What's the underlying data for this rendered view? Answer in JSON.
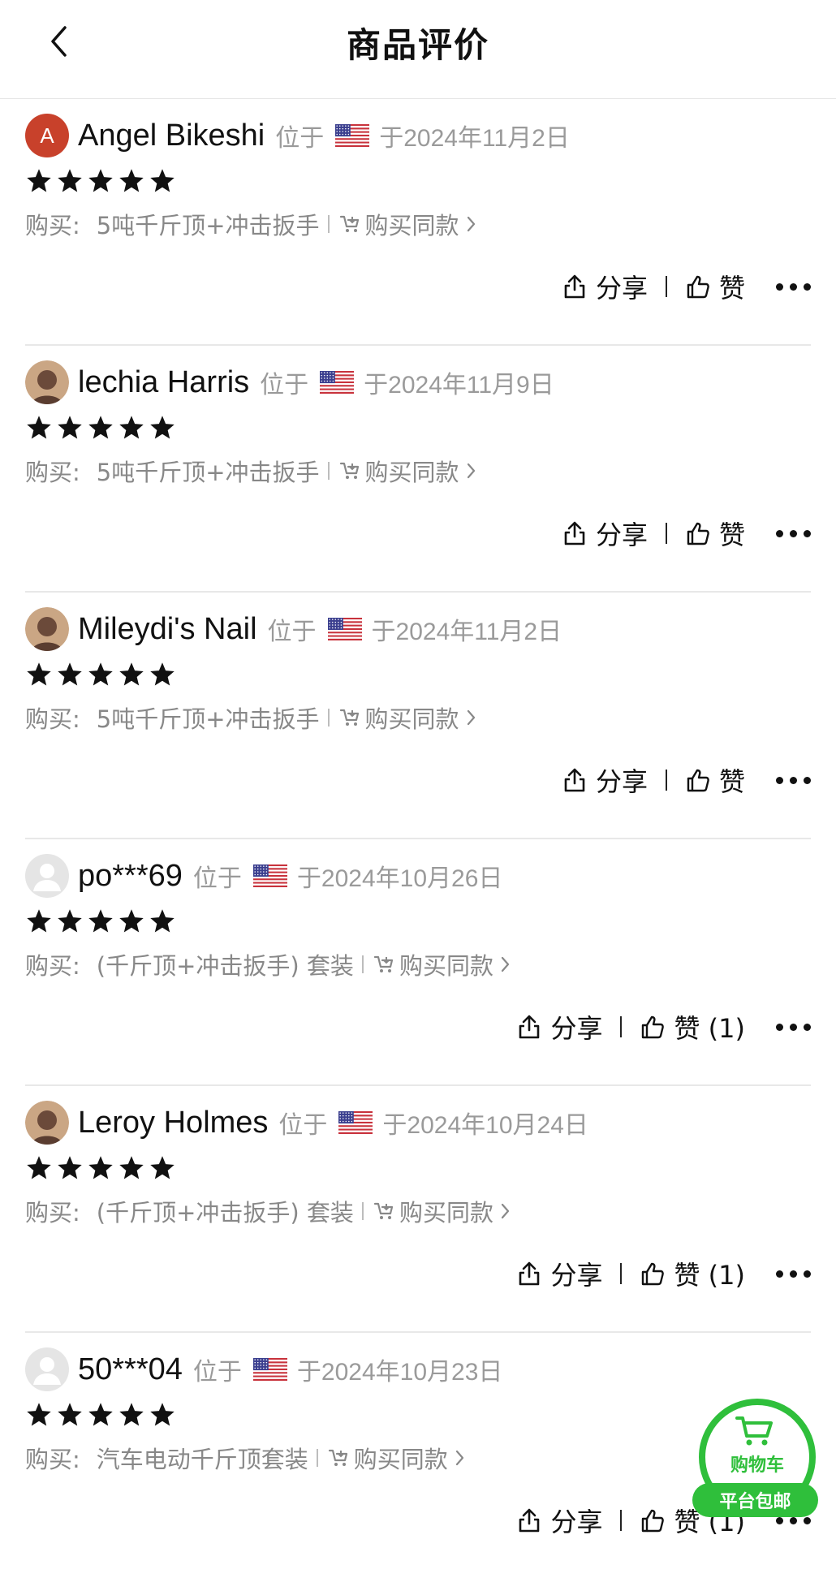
{
  "header": {
    "title": "商品评价"
  },
  "labels": {
    "located": "位于",
    "purchase": "购买:",
    "buy_same": "购买同款",
    "share": "分享",
    "like": "赞"
  },
  "reviews": [
    {
      "username": "Angel Bikeshi",
      "avatar": "letter-avatar",
      "avatar_letter": "A",
      "country_flag": "us-flag-icon",
      "date": "于2024年11月2日",
      "rating": 5,
      "product": "5吨千斤顶+冲击扳手",
      "like_text": "赞"
    },
    {
      "username": "lechia Harris",
      "avatar": "photo-avatar",
      "country_flag": "us-flag-icon",
      "date": "于2024年11月9日",
      "rating": 5,
      "product": "5吨千斤顶+冲击扳手",
      "like_text": "赞"
    },
    {
      "username": "Mileydi's Nail",
      "avatar": "photo-avatar",
      "country_flag": "us-flag-icon",
      "date": "于2024年11月2日",
      "rating": 5,
      "product": "5吨千斤顶+冲击扳手",
      "like_text": "赞"
    },
    {
      "username": "po***69",
      "avatar": "default-avatar",
      "country_flag": "us-flag-icon",
      "date": "于2024年10月26日",
      "rating": 5,
      "product": "(千斤顶+冲击扳手) 套装",
      "like_text": "赞 (1)"
    },
    {
      "username": "Leroy Holmes",
      "avatar": "photo-avatar",
      "country_flag": "us-flag-icon",
      "date": "于2024年10月24日",
      "rating": 5,
      "product": "(千斤顶+冲击扳手) 套装",
      "like_text": "赞 (1)"
    },
    {
      "username": "50***04",
      "avatar": "default-avatar",
      "country_flag": "us-flag-icon",
      "date": "于2024年10月23日",
      "rating": 5,
      "product": "汽车电动千斤顶套装",
      "like_text": "赞 (1)"
    }
  ],
  "cart_fab": {
    "label": "购物车",
    "banner": "平台包邮"
  },
  "colors": {
    "accent_green": "#2fbf3b",
    "secondary_text": "#9a9a9a",
    "avatar_red": "#c8412b"
  }
}
